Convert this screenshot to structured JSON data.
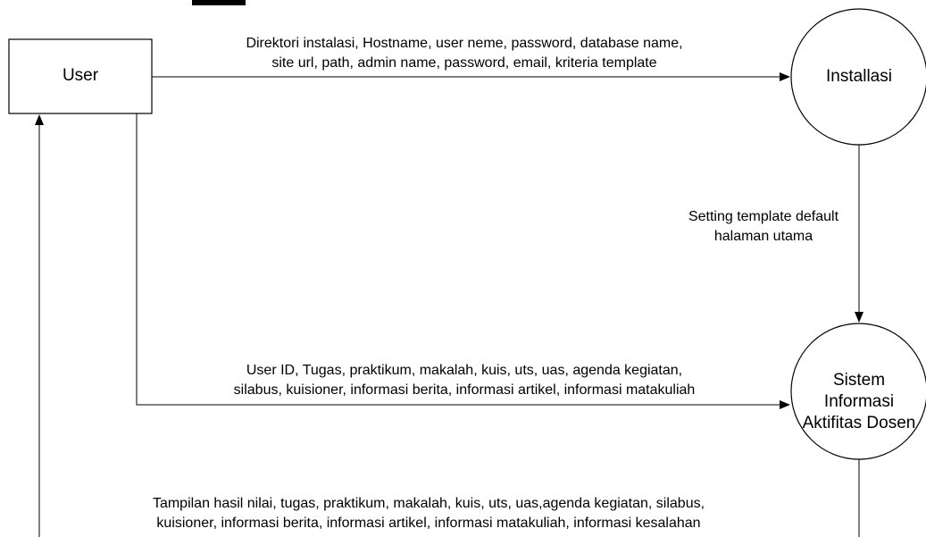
{
  "nodes": {
    "user": {
      "label": "User"
    },
    "installasi": {
      "label": "Installasi"
    },
    "sistem": {
      "lines": [
        "Sistem",
        "Informasi",
        "Aktifitas Dosen"
      ]
    }
  },
  "flows": {
    "user_to_installasi": {
      "lines": [
        "Direktori instalasi, Hostname, user neme, password, database name,",
        "site url, path, admin name, password, email, kriteria template"
      ]
    },
    "installasi_to_sistem": {
      "lines": [
        "Setting template default",
        "halaman utama"
      ]
    },
    "user_to_sistem": {
      "lines": [
        "User ID, Tugas, praktikum, makalah, kuis, uts, uas, agenda kegiatan,",
        "silabus, kuisioner, informasi berita, informasi artikel, informasi matakuliah"
      ]
    },
    "sistem_to_user": {
      "lines": [
        "Tampilan hasil nilai, tugas, praktikum, makalah, kuis, uts, uas,agenda kegiatan, silabus,",
        "kuisioner, informasi berita, informasi artikel, informasi matakuliah, informasi kesalahan"
      ]
    }
  },
  "colors": {
    "stroke": "#000000",
    "background": "#ffffff"
  }
}
